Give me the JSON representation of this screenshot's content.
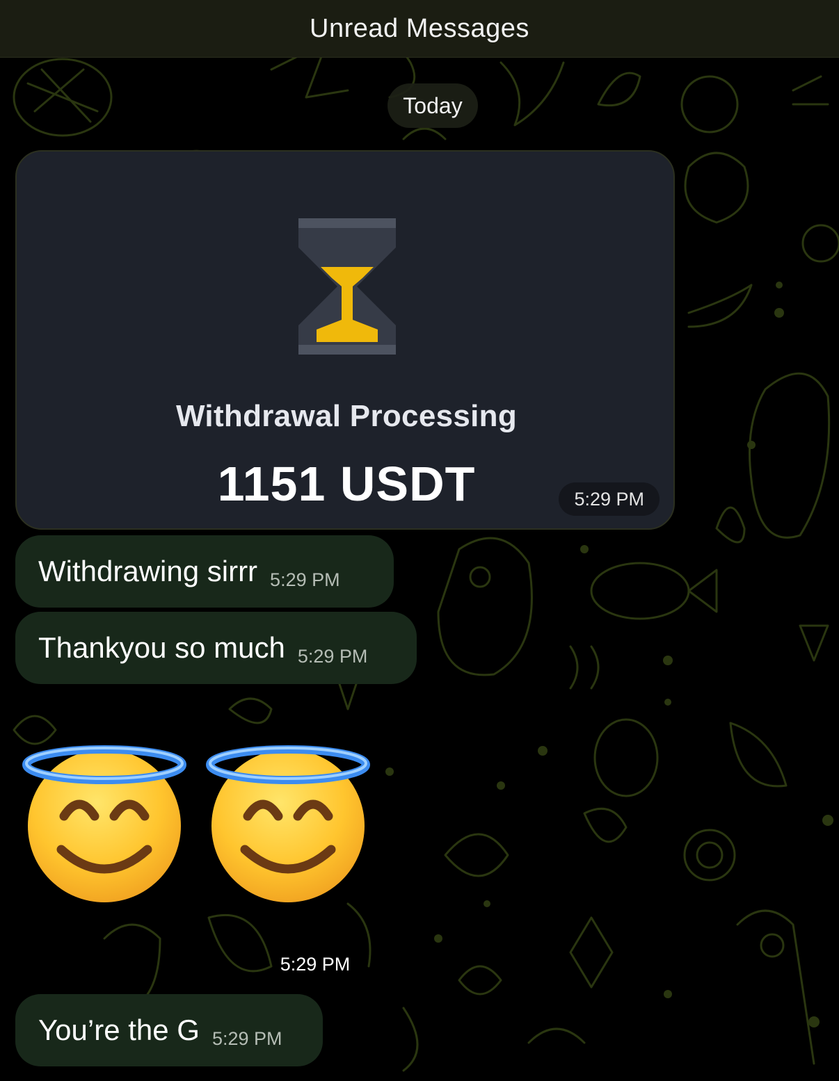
{
  "header": {
    "unread_label": "Unread Messages"
  },
  "date_separator": "Today",
  "withdrawal_card": {
    "icon": "hourglass-icon",
    "title": "Withdrawal Processing",
    "amount": "1151 USDT",
    "time": "5:29 PM"
  },
  "messages": [
    {
      "text": "Withdrawing sirrr",
      "time": "5:29 PM"
    },
    {
      "text": "Thankyou so much",
      "time": "5:29 PM"
    }
  ],
  "emoji_message": {
    "emojis": [
      "smiling-face-with-halo-icon",
      "smiling-face-with-halo-icon"
    ],
    "time": "5:29 PM"
  },
  "last_message": {
    "text": "You’re the G",
    "time": "5:29 PM"
  },
  "colors": {
    "background": "#000000",
    "pattern": "#2e3a12",
    "bubble": "#18281a",
    "card": "#1e222b",
    "hourglass_sand": "#f0b90b"
  }
}
